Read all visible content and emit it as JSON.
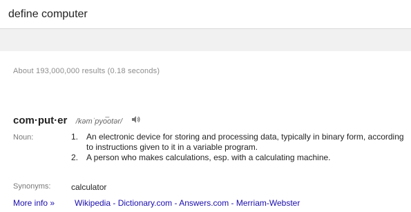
{
  "search": {
    "value": "define computer"
  },
  "result_stats": "About 193,000,000 results (0.18 seconds)",
  "entry": {
    "headword": "com·put·er",
    "pronunciation": "/kəmˈpyo͞otər/",
    "speaker_icon": "speaker-icon",
    "part_of_speech": "Noun:",
    "definitions": [
      {
        "num": "1.",
        "text": "An electronic device for storing and processing data, typically in binary form, according to instructions given to it in a variable program."
      },
      {
        "num": "2.",
        "text": "A person who makes calculations, esp. with a calculating machine."
      }
    ],
    "synonyms_label": "Synonyms:",
    "synonyms": "calculator",
    "more_info": "More info »",
    "sources": [
      "Wikipedia",
      "Dictionary.com",
      "Answers.com",
      "Merriam-Webster"
    ],
    "separator": " - "
  },
  "colors": {
    "link": "#1a0dab",
    "muted": "#8c8c8c",
    "band": "#f1f1f1"
  }
}
